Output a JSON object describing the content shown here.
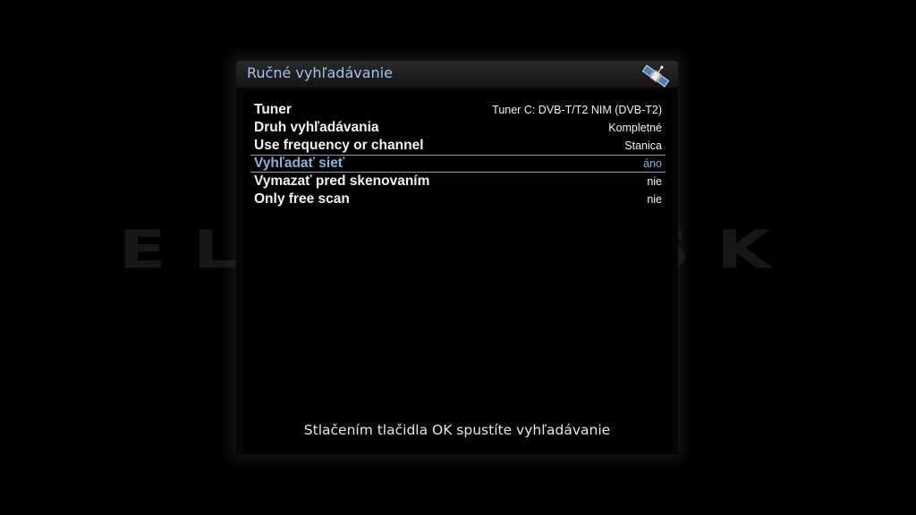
{
  "watermark": {
    "text": "ELLANO.SK"
  },
  "dialog": {
    "title": "Ručné vyhľadávanie",
    "icon": "satellite-icon",
    "hint": "Stlačením tlačidla OK spustíte vyhľadávanie"
  },
  "settings": [
    {
      "label": "Tuner",
      "value": "Tuner C: DVB-T/T2 NIM (DVB-T2)"
    },
    {
      "label": "Druh vyhľadávania",
      "value": "Kompletné"
    },
    {
      "label": "Use frequency or channel",
      "value": "Stanica"
    },
    {
      "label": "Vyhľadať sieť",
      "value": "áno"
    },
    {
      "label": "Vymazať pred skenovaním",
      "value": "nie"
    },
    {
      "label": "Only free scan",
      "value": "nie"
    }
  ],
  "selected_index": 3,
  "colors": {
    "title_text": "#9ec3ea",
    "selected_text": "#8ab0dd",
    "background": "#000000"
  }
}
